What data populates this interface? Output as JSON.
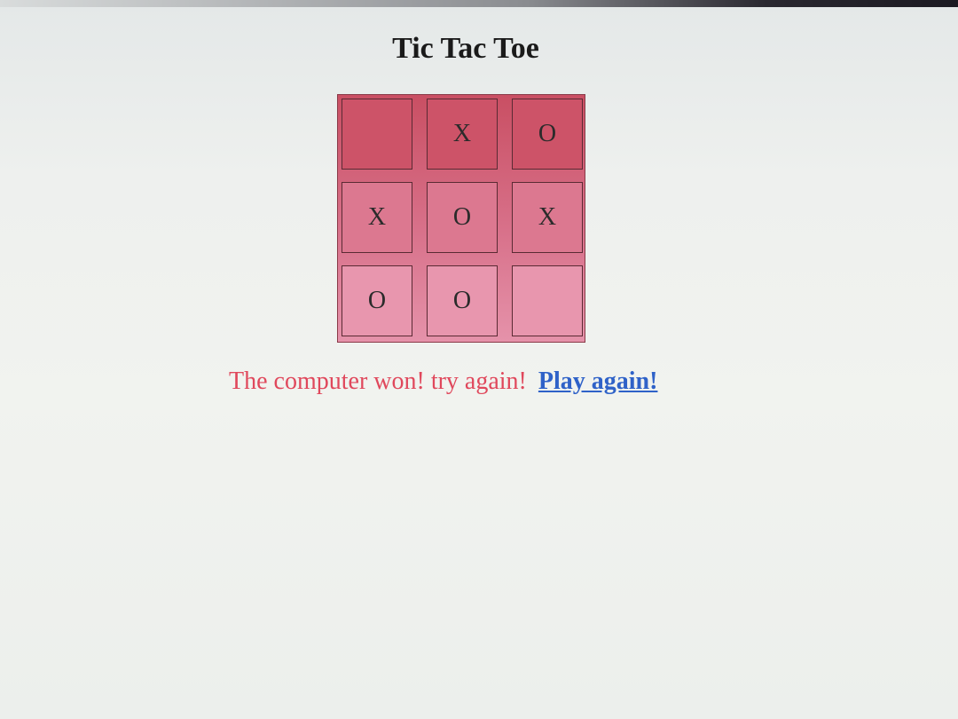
{
  "page": {
    "title": "Tic Tac Toe"
  },
  "board": {
    "rows": [
      [
        "",
        "X",
        "O"
      ],
      [
        "X",
        "O",
        "X"
      ],
      [
        "O",
        "O",
        ""
      ]
    ]
  },
  "status": {
    "message": "The computer won! try again!",
    "link_label": "Play again!"
  },
  "colors": {
    "board_top": "#c94f63",
    "board_bottom": "#e592aa",
    "message": "#e0485c",
    "link": "#2f62c8"
  }
}
